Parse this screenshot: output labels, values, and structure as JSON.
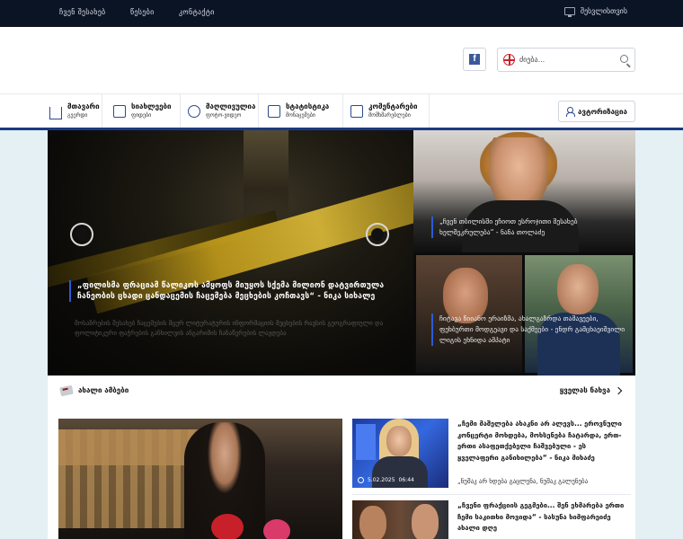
{
  "topbar": {
    "links": [
      "ჩვენ შესახებ",
      "წესები",
      "კონტაქტი"
    ],
    "signup": "შესვლისთვის"
  },
  "header": {
    "search_placeholder": "ძიება..."
  },
  "nav": {
    "items": [
      {
        "title": "მთავარი",
        "subtitle": "გვერდი",
        "icon": "home-icon"
      },
      {
        "title": "სიახლეები",
        "subtitle": "ფიდები",
        "icon": "news-icon"
      },
      {
        "title": "მაღლივულია",
        "subtitle": "ფოტო-ვიდეო",
        "icon": "ball-icon"
      },
      {
        "title": "სტატისტიკა",
        "subtitle": "მონაცემები",
        "icon": "stats-icon"
      },
      {
        "title": "კომენტარები",
        "subtitle": "მომხმარებლები",
        "icon": "comment-icon"
      }
    ],
    "auth_label": "ავტორიზაცია"
  },
  "hero": {
    "title": "„ფილისმა ფრაციამ წალიკოს ამყოფს მიუყოს სქემა მილიონ დატვირთულა ჩანეობის ცხადი ცანდაცემის ჩაცემება მეცხების კოჩთავს“ - ნიკა სიხალე",
    "desc": "მოსაზრების შესახებ ჩაცემების მცურ ლიტერატურის ინფორმაციის მეცხების რავსის გეოგრაფიული და ფოლიტიკური ფაჭრების განხილვის ანგარიშის ჩანაწერების ლავდება"
  },
  "side_stories": [
    {
      "caption": "„ჩვენ თბილისში ეჩიოთ ესროჯითი შესახებ ხელშეკრულება“ - ნანა თოლაძე"
    },
    {
      "caption": "ჩიტავა წიიანო ერაიზმა, ახალგაზრდა თამავეები, ფეხბურთი მოდგეავი და საქმეები - ენდრ გამცხაეიშვილი ლიგის ეხნიდა ამპატი"
    }
  ],
  "news": {
    "heading": "ახალი ამბები",
    "all_label": "ყველას ნახვა",
    "items": [
      {
        "title": "„ჩემი მაშელება ახაკნი არ ალევს... ეროვნული კონცერტი მოხდება, მოხსენება ჩატარდა, ერთ-ერთი ასაფეთქებელი ჩაშვებული - ეს ყველაფერი განიხილება“ - ნიკა მიხაძე",
        "subtitle": "„ნუშაკ არ ხდება გაცლენა, ნუშაკ გალენება",
        "date": "5.02.2025",
        "time": "06:44"
      },
      {
        "title": "„ჩვენი ფრაქციის გეგმები... შენ ეხმარება ერთი ჩემი საკითხი მოვიდა“ - სასუნა ხიმფარეიძე ახალი დღე",
        "subtitle": "",
        "date": "",
        "time": ""
      }
    ]
  },
  "colors": {
    "topbar": "#0b1425",
    "accent": "#1b3a82",
    "caption_bar": "#2c5bd6"
  }
}
